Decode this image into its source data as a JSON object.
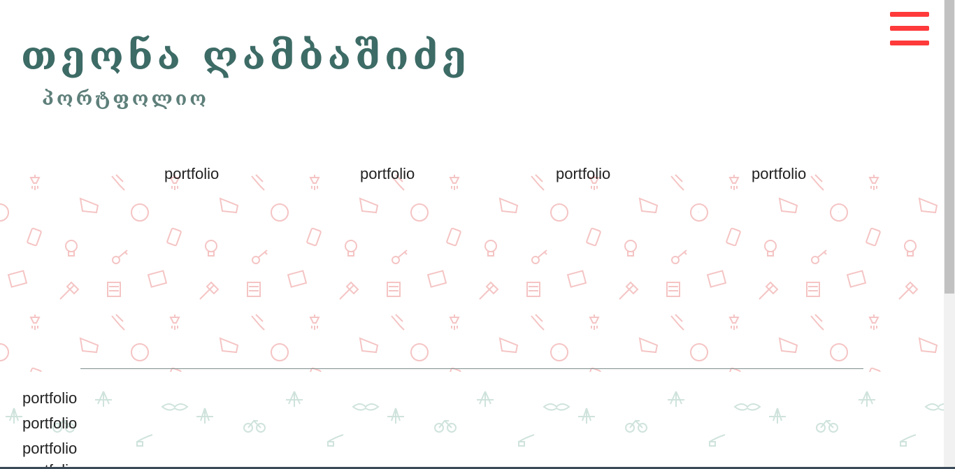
{
  "header": {
    "title": "თეონა ღამბაშიძე",
    "subtitle": "პორტფოლიო"
  },
  "menu": {
    "icon": "hamburger-menu-icon",
    "color": "#ff3a3a"
  },
  "nav": {
    "items": [
      {
        "label": "portfolio"
      },
      {
        "label": "portfolio"
      },
      {
        "label": "portfolio"
      },
      {
        "label": "portfolio"
      }
    ]
  },
  "side_links": {
    "items": [
      {
        "label": "portfolio"
      },
      {
        "label": "portfolio"
      },
      {
        "label": "portfolio"
      },
      {
        "label": "portfolio"
      }
    ]
  },
  "colors": {
    "title": "#3d6b66",
    "accent": "#ff3a3a",
    "pattern_red": "#f8c9c9",
    "pattern_green": "#cfe3dc"
  }
}
